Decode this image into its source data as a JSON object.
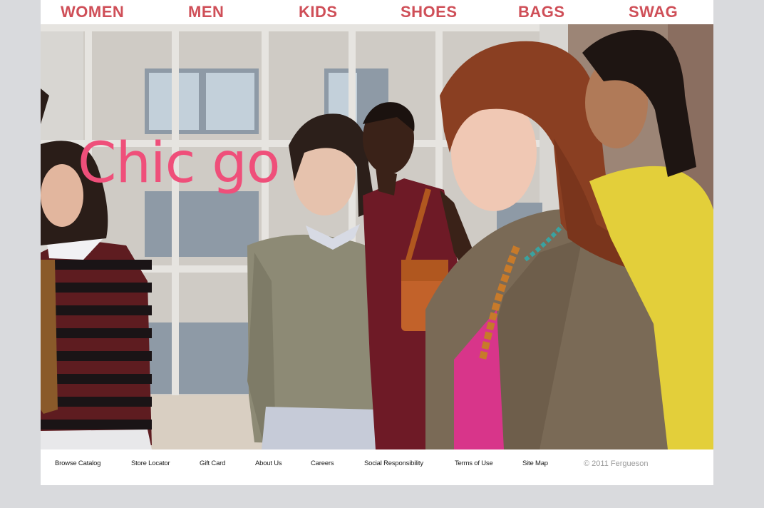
{
  "nav": {
    "items": [
      {
        "label": "WOMEN"
      },
      {
        "label": "MEN"
      },
      {
        "label": "KIDS"
      },
      {
        "label": "SHOES"
      },
      {
        "label": "BAGS"
      },
      {
        "label": "SWAG"
      }
    ]
  },
  "hero": {
    "title": "Chic go"
  },
  "footer": {
    "links": [
      {
        "label": "Browse Catalog"
      },
      {
        "label": "Store Locator"
      },
      {
        "label": "Gift Card"
      },
      {
        "label": "About Us"
      },
      {
        "label": "Careers"
      },
      {
        "label": "Social Responsibility"
      },
      {
        "label": "Terms of Use"
      },
      {
        "label": "Site Map"
      }
    ],
    "copyright": "© 2011 Fergueson"
  },
  "colors": {
    "nav_text": "#cf4f58",
    "hero_title": "#ef4f7a",
    "page_background": "#d9dadd"
  }
}
